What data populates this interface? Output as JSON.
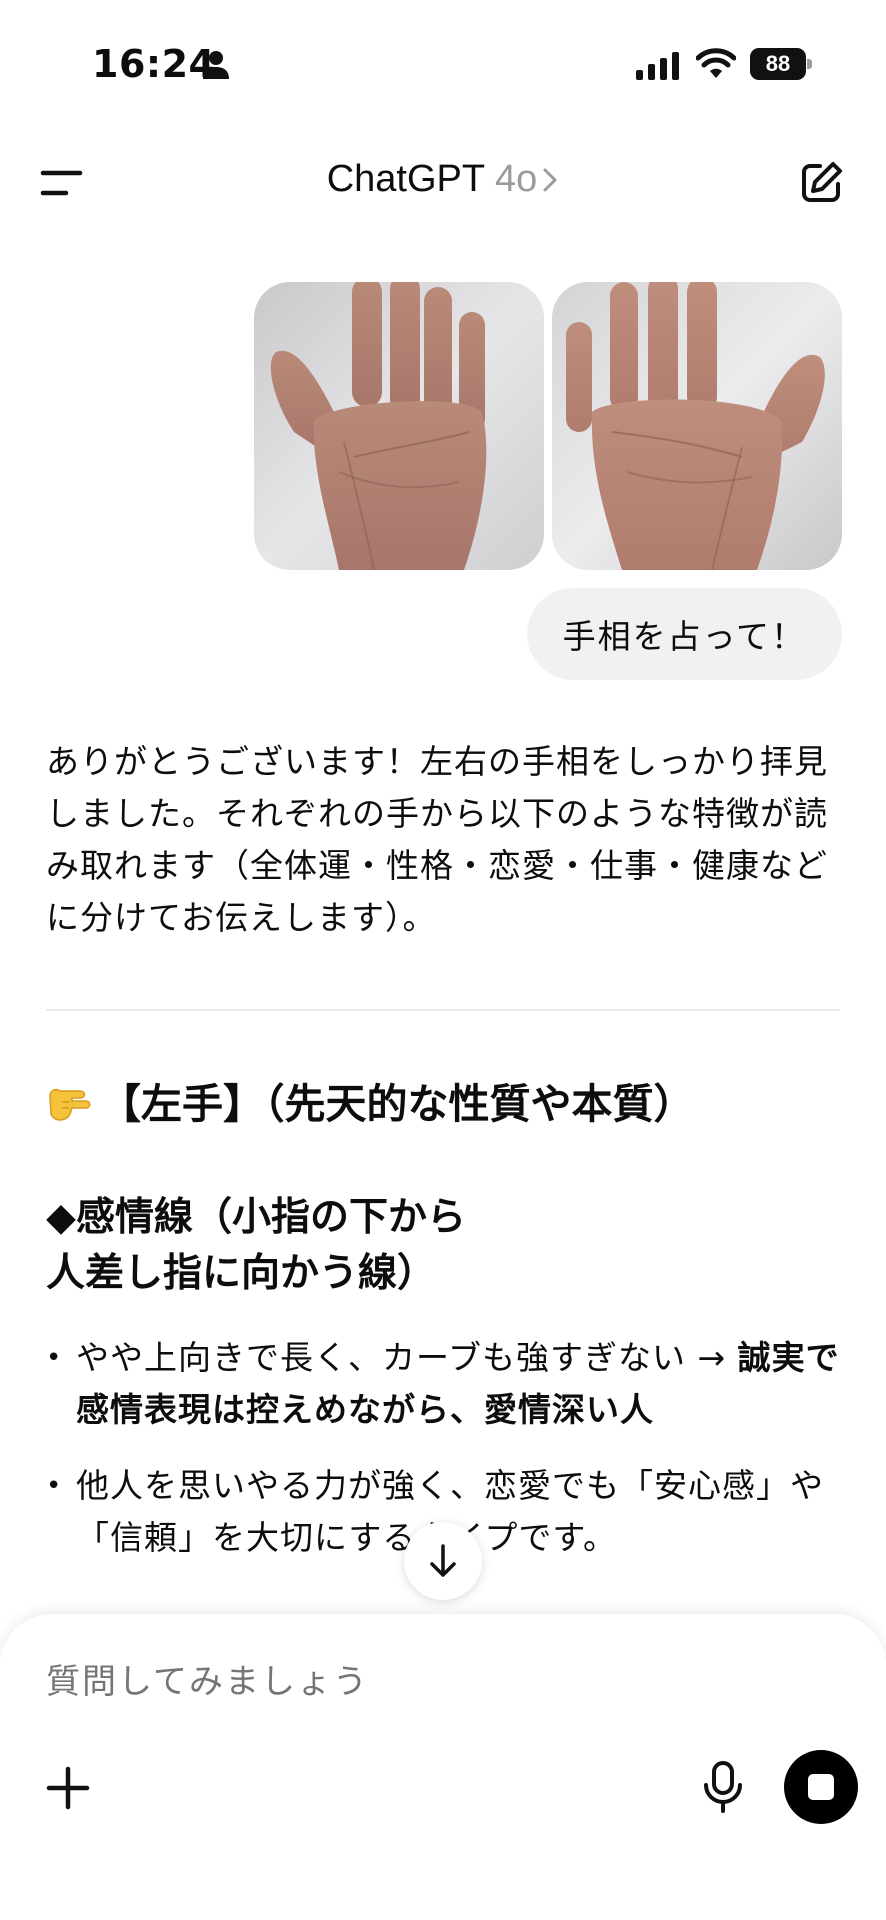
{
  "status_bar": {
    "time": "16:24",
    "battery": "88"
  },
  "header": {
    "title": "ChatGPT",
    "model": "4o"
  },
  "user_message": {
    "text": "手相を占って！"
  },
  "assistant": {
    "intro": "ありがとうございます！左右の手相をしっかり拝見しました。それぞれの手から以下のような特徴が読み取れます（全体運・性格・恋愛・仕事・健康などに分けてお伝えします）。",
    "section_heading": "【左手】（先天的な性質や本質）",
    "sub_heading_line1": "◆感情線（小指の下から",
    "sub_heading_line2": "人差し指に向かう線）",
    "bullets": [
      {
        "plain": "やや上向きで長く、カーブも強すぎない → ",
        "bold": "誠実で感情表現は控えめながら、愛情深い人"
      },
      {
        "plain": "他人を思いやる力が強く、恋愛でも「安心感」や「信頼」を大切にするタイプです。",
        "bold": ""
      }
    ]
  },
  "composer": {
    "placeholder": "質問してみましょう"
  },
  "icons": {
    "menu": "menu-icon",
    "edit": "new-chat-icon",
    "chevron": "chevron-right-icon",
    "plus": "plus-icon",
    "mic": "microphone-icon",
    "stop": "stop-icon",
    "scroll": "arrow-down-icon",
    "section": "pointing-hand-emoji"
  }
}
